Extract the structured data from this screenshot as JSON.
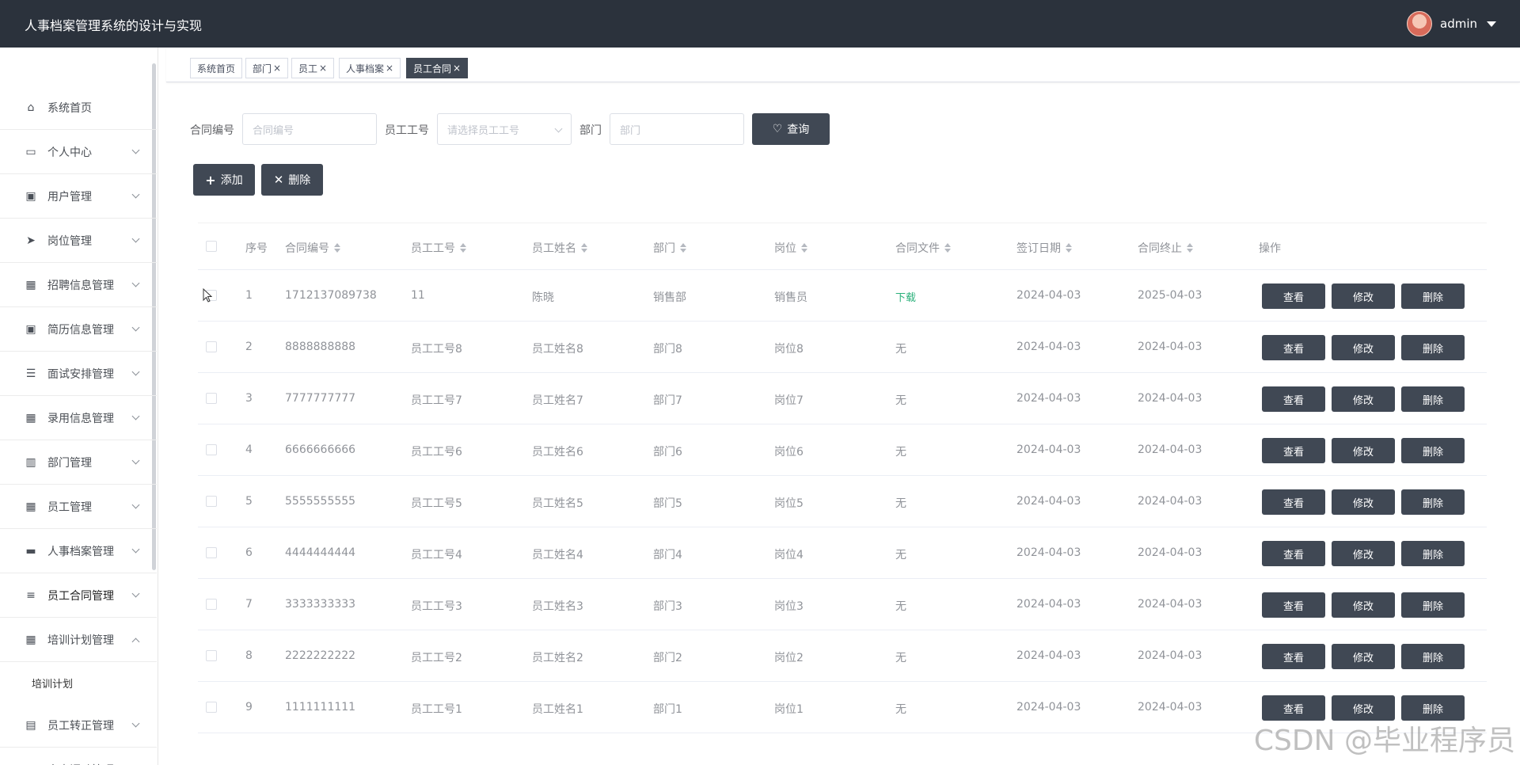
{
  "header": {
    "title": "人事档案管理系统的设计与实现",
    "username": "admin"
  },
  "sidebar": {
    "items": [
      {
        "label": "系统首页",
        "icon": "home-icon",
        "glyph": "⌂",
        "arrow": ""
      },
      {
        "label": "个人中心",
        "icon": "card-icon",
        "glyph": "▭",
        "arrow": "down"
      },
      {
        "label": "用户管理",
        "icon": "clipboard-icon",
        "glyph": "▣",
        "arrow": "down"
      },
      {
        "label": "岗位管理",
        "icon": "send-icon",
        "glyph": "➤",
        "arrow": "down"
      },
      {
        "label": "招聘信息管理",
        "icon": "grid-icon",
        "glyph": "▦",
        "arrow": "down"
      },
      {
        "label": "简历信息管理",
        "icon": "clipboard-check-icon",
        "glyph": "▣",
        "arrow": "down"
      },
      {
        "label": "面试安排管理",
        "icon": "list-icon",
        "glyph": "☰",
        "arrow": "down"
      },
      {
        "label": "录用信息管理",
        "icon": "grid-icon",
        "glyph": "▦",
        "arrow": "down"
      },
      {
        "label": "部门管理",
        "icon": "building-icon",
        "glyph": "▥",
        "arrow": "down"
      },
      {
        "label": "员工管理",
        "icon": "apps-icon",
        "glyph": "▦",
        "arrow": "down"
      },
      {
        "label": "人事档案管理",
        "icon": "briefcase-icon",
        "glyph": "▬",
        "arrow": "down"
      },
      {
        "label": "员工合同管理",
        "icon": "sliders-icon",
        "glyph": "≡",
        "arrow": "down"
      },
      {
        "label": "培训计划管理",
        "icon": "grid-icon",
        "glyph": "▦",
        "arrow": "up"
      },
      {
        "label": "员工转正管理",
        "icon": "chat-icon",
        "glyph": "▤",
        "arrow": "down"
      },
      {
        "label": "人事调动管理",
        "icon": "ticket-icon",
        "glyph": "▰",
        "arrow": "down"
      }
    ],
    "sub_item": "培训计划"
  },
  "tabs": [
    {
      "label": "系统首页",
      "closable": false,
      "active": false
    },
    {
      "label": "部门",
      "closable": true,
      "active": false
    },
    {
      "label": "员工",
      "closable": true,
      "active": false
    },
    {
      "label": "人事档案",
      "closable": true,
      "active": false
    },
    {
      "label": "员工合同",
      "closable": true,
      "active": true
    }
  ],
  "search": {
    "contract_no_label": "合同编号",
    "contract_no_placeholder": "合同编号",
    "emp_no_label": "员工工号",
    "emp_no_placeholder": "请选择员工工号",
    "dept_label": "部门",
    "dept_placeholder": "部门",
    "query_button": "查询"
  },
  "actions": {
    "add": "添加",
    "delete": "删除"
  },
  "table": {
    "columns": [
      "序号",
      "合同编号",
      "员工工号",
      "员工姓名",
      "部门",
      "岗位",
      "合同文件",
      "签订日期",
      "合同终止",
      "操作"
    ],
    "rows": [
      {
        "idx": "1",
        "contract_no": "1712137089738",
        "emp_no": "11",
        "name": "陈晓",
        "dept": "销售部",
        "post": "销售员",
        "file": "下载",
        "sign": "2024-04-03",
        "end": "2025-04-03"
      },
      {
        "idx": "2",
        "contract_no": "8888888888",
        "emp_no": "员工工号8",
        "name": "员工姓名8",
        "dept": "部门8",
        "post": "岗位8",
        "file": "无",
        "sign": "2024-04-03",
        "end": "2024-04-03"
      },
      {
        "idx": "3",
        "contract_no": "7777777777",
        "emp_no": "员工工号7",
        "name": "员工姓名7",
        "dept": "部门7",
        "post": "岗位7",
        "file": "无",
        "sign": "2024-04-03",
        "end": "2024-04-03"
      },
      {
        "idx": "4",
        "contract_no": "6666666666",
        "emp_no": "员工工号6",
        "name": "员工姓名6",
        "dept": "部门6",
        "post": "岗位6",
        "file": "无",
        "sign": "2024-04-03",
        "end": "2024-04-03"
      },
      {
        "idx": "5",
        "contract_no": "5555555555",
        "emp_no": "员工工号5",
        "name": "员工姓名5",
        "dept": "部门5",
        "post": "岗位5",
        "file": "无",
        "sign": "2024-04-03",
        "end": "2024-04-03"
      },
      {
        "idx": "6",
        "contract_no": "4444444444",
        "emp_no": "员工工号4",
        "name": "员工姓名4",
        "dept": "部门4",
        "post": "岗位4",
        "file": "无",
        "sign": "2024-04-03",
        "end": "2024-04-03"
      },
      {
        "idx": "7",
        "contract_no": "3333333333",
        "emp_no": "员工工号3",
        "name": "员工姓名3",
        "dept": "部门3",
        "post": "岗位3",
        "file": "无",
        "sign": "2024-04-03",
        "end": "2024-04-03"
      },
      {
        "idx": "8",
        "contract_no": "2222222222",
        "emp_no": "员工工号2",
        "name": "员工姓名2",
        "dept": "部门2",
        "post": "岗位2",
        "file": "无",
        "sign": "2024-04-03",
        "end": "2024-04-03"
      },
      {
        "idx": "9",
        "contract_no": "1111111111",
        "emp_no": "员工工号1",
        "name": "员工姓名1",
        "dept": "部门1",
        "post": "岗位1",
        "file": "无",
        "sign": "2024-04-03",
        "end": "2024-04-03"
      }
    ],
    "row_buttons": {
      "view": "查看",
      "edit": "修改",
      "delete": "删除"
    }
  },
  "watermark": "CSDN @毕业程序员",
  "colors": {
    "header_bg": "#2b323c",
    "button_dark": "#404854",
    "download_link": "#2ab07a"
  }
}
